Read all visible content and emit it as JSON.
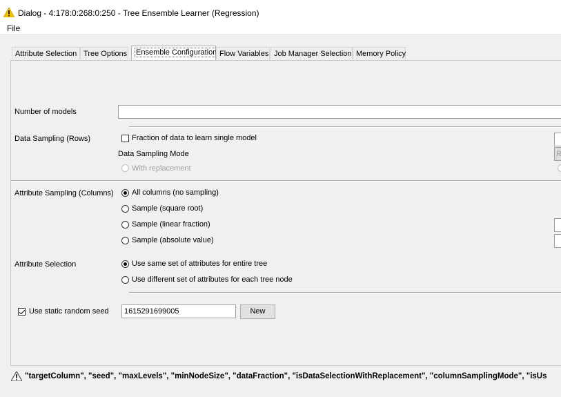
{
  "window": {
    "title": "Dialog - 4:178:0:268:0:250 - Tree Ensemble Learner (Regression)",
    "icon": "warning-icon"
  },
  "menu": {
    "file": "File"
  },
  "tabs": [
    {
      "label": "Attribute Selection"
    },
    {
      "label": "Tree Options"
    },
    {
      "label": "Ensemble Configuration",
      "active": true
    },
    {
      "label": "Flow Variables"
    },
    {
      "label": "Job Manager Selection"
    },
    {
      "label": "Memory Policy"
    }
  ],
  "ensemble": {
    "number_of_models_label": "Number of models",
    "number_of_models_value": "",
    "data_sampling_label": "Data Sampling (Rows)",
    "fraction_checkbox_label": "Fraction of data to learn single model",
    "fraction_checked": false,
    "sampling_mode_label": "Data Sampling Mode",
    "sampling_mode_edge_text": "R",
    "with_replacement_label": "With replacement",
    "attribute_sampling_label": "Attribute Sampling (Columns)",
    "column_options": [
      {
        "label": "All columns (no sampling)",
        "selected": true
      },
      {
        "label": "Sample (square root)",
        "selected": false
      },
      {
        "label": "Sample (linear fraction)",
        "selected": false
      },
      {
        "label": "Sample (absolute value)",
        "selected": false
      }
    ],
    "attribute_selection_label": "Attribute Selection",
    "attribute_selection_options": [
      {
        "label": "Use same set of attributes for entire tree",
        "selected": true
      },
      {
        "label": "Use different set of attributes for each tree node",
        "selected": false
      }
    ],
    "static_seed_label": "Use static random seed",
    "static_seed_checked": true,
    "seed_value": "1615291699005",
    "new_button": "New"
  },
  "status": {
    "icon": "warning-icon",
    "message": "\"targetColumn\", \"seed\", \"maxLevels\", \"minNodeSize\", \"dataFraction\", \"isDataSelectionWithReplacement\", \"columnSamplingMode\", \"isUs"
  },
  "colors": {
    "warning": "#f5c400",
    "background": "#f0f0f0",
    "tab_active_border": "#adadad"
  }
}
